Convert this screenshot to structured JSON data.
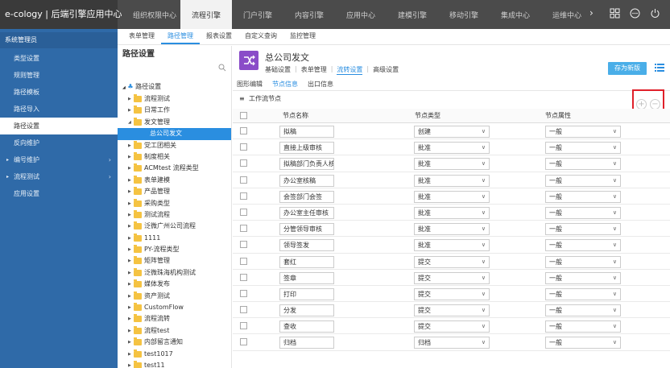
{
  "app": {
    "title": "e-cology | 后端引擎应用中心"
  },
  "topnav": {
    "items": [
      "组织权限中心",
      "流程引擎",
      "门户引擎",
      "内容引擎",
      "应用中心",
      "建模引擎",
      "移动引擎",
      "集成中心",
      "运维中心"
    ],
    "active": "流程引擎"
  },
  "subnav": {
    "items": [
      "表单管理",
      "路径管理",
      "报表设置",
      "自定义查询",
      "监控管理"
    ],
    "active": "路径管理"
  },
  "sidebar": {
    "title": "系统管理员",
    "items": [
      {
        "label": "类型设置",
        "caret": false
      },
      {
        "label": "规则管理",
        "caret": false
      },
      {
        "label": "路径模板",
        "caret": false
      },
      {
        "label": "路径导入",
        "caret": false
      },
      {
        "label": "路径设置",
        "caret": false,
        "active": true
      },
      {
        "label": "反向维护",
        "caret": false
      },
      {
        "label": "编号维护",
        "caret": true
      },
      {
        "label": "流程测试",
        "caret": true
      },
      {
        "label": "应用设置",
        "caret": false
      }
    ]
  },
  "tree": {
    "title": "路径设置",
    "root": "路径设置",
    "nodes": [
      {
        "label": "流程测试",
        "expanded": false
      },
      {
        "label": "日常工作",
        "expanded": false
      },
      {
        "label": "发文管理",
        "expanded": true
      },
      {
        "label": "总公司发文",
        "child": true,
        "selected": true
      },
      {
        "label": "党工团相关",
        "expanded": false
      },
      {
        "label": "制度相关",
        "expanded": false
      },
      {
        "label": "ACMtest 流程类型",
        "expanded": false
      },
      {
        "label": "表单建模",
        "expanded": false
      },
      {
        "label": "产品管理",
        "expanded": false
      },
      {
        "label": "采购类型",
        "expanded": false
      },
      {
        "label": "测试流程",
        "expanded": false
      },
      {
        "label": "泛微广州公司流程",
        "expanded": false
      },
      {
        "label": "1111",
        "expanded": false
      },
      {
        "label": "PY-流程类型",
        "expanded": false
      },
      {
        "label": "矩阵管理",
        "expanded": false
      },
      {
        "label": "泛微珠海机构测试",
        "expanded": false
      },
      {
        "label": "媒体发布",
        "expanded": false
      },
      {
        "label": "资产测试",
        "expanded": false
      },
      {
        "label": "CustomFlow",
        "expanded": false
      },
      {
        "label": "流程流转",
        "expanded": false
      },
      {
        "label": "流程test",
        "expanded": false
      },
      {
        "label": "内部留言通知",
        "expanded": false
      },
      {
        "label": "test1017",
        "expanded": false
      },
      {
        "label": "test11",
        "expanded": false
      }
    ]
  },
  "workflow": {
    "title": "总公司发文",
    "tabs": [
      "基础设置",
      "表单管理",
      "流转设置",
      "高级设置"
    ],
    "active_tab": "流转设置",
    "save_label": "存为新版",
    "sub_tabs": [
      "图形编辑",
      "节点信息",
      "出口信息"
    ],
    "active_sub_tab": "节点信息",
    "section_title": "工作流节点"
  },
  "table": {
    "headers": {
      "name": "节点名称",
      "type": "节点类型",
      "attr": "节点属性"
    },
    "rows": [
      {
        "name": "拟稿",
        "type": "创建",
        "attr": "一般"
      },
      {
        "name": "直接上级审核",
        "type": "批准",
        "attr": "一般"
      },
      {
        "name": "拟稿部门负责人核稿",
        "type": "批准",
        "attr": "一般"
      },
      {
        "name": "办公室核稿",
        "type": "批准",
        "attr": "一般"
      },
      {
        "name": "会签部门会签",
        "type": "批准",
        "attr": "一般"
      },
      {
        "name": "办公室主任审核",
        "type": "批准",
        "attr": "一般"
      },
      {
        "name": "分管领导审核",
        "type": "批准",
        "attr": "一般"
      },
      {
        "name": "领导签发",
        "type": "批准",
        "attr": "一般"
      },
      {
        "name": "套红",
        "type": "提交",
        "attr": "一般"
      },
      {
        "name": "签章",
        "type": "提交",
        "attr": "一般"
      },
      {
        "name": "打印",
        "type": "提交",
        "attr": "一般"
      },
      {
        "name": "分发",
        "type": "提交",
        "attr": "一般"
      },
      {
        "name": "查收",
        "type": "提交",
        "attr": "一般"
      },
      {
        "name": "归档",
        "type": "归档",
        "attr": "一般"
      }
    ]
  },
  "colors": {
    "sidebar": "#2f6aa8",
    "accent": "#2a8ee0",
    "topbar": "#4b4b4b",
    "workflow_icon": "#8a4cc8",
    "highlight_box": "#e0202a"
  }
}
